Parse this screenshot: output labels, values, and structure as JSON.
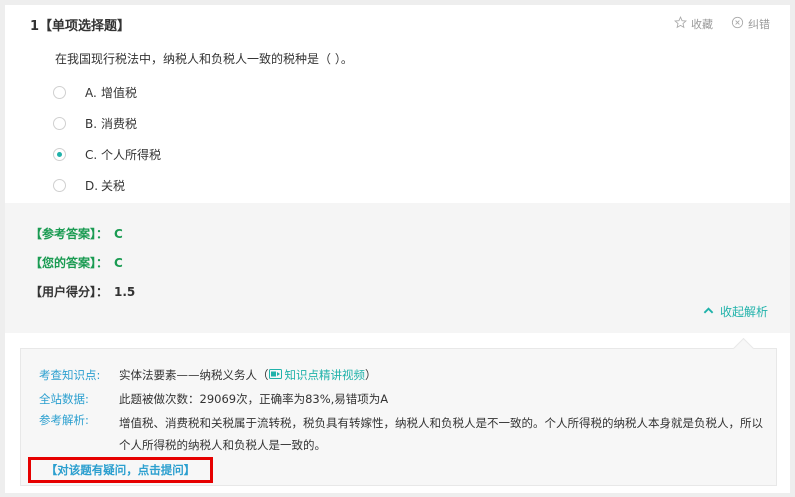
{
  "question": {
    "number_label": "1【单项选择题】",
    "stem": "在我国现行税法中，纳税人和负税人一致的税种是（ ）。",
    "favorite_label": "收藏",
    "report_label": "纠错",
    "options": [
      {
        "letter": "A.",
        "text": "增值税",
        "selected": false
      },
      {
        "letter": "B.",
        "text": "消费税",
        "selected": false
      },
      {
        "letter": "C.",
        "text": "个人所得税",
        "selected": true
      },
      {
        "letter": "D.",
        "text": "关税",
        "selected": false
      }
    ]
  },
  "answer": {
    "reference_label": "【参考答案】：",
    "reference_value": "C",
    "yours_label": "【您的答案】：",
    "yours_value": "C",
    "score_label": "【用户得分】：",
    "score_value": "1.5",
    "collapse_label": "收起解析"
  },
  "analysis": {
    "knowledge_label": "考查知识点:",
    "knowledge_text": "实体法要素——纳税义务人（",
    "video_link": "知识点精讲视频",
    "knowledge_close": "）",
    "stats_label": "全站数据:",
    "stats_text": "此题被做次数：29069次，正确率为83%,易错项为A",
    "ref_label": "参考解析:",
    "ref_text": "增值税、消费税和关税属于流转税，税负具有转嫁性，纳税人和负税人是不一致的。个人所得税的纳税人本身就是负税人，所以个人所得税的纳税人和负税人是一致的。",
    "ask_button": "【对该题有疑问，点击提问】"
  },
  "colors": {
    "accent": "#20b2aa",
    "label_blue": "#2b9fcf",
    "answer_green": "#1a9b52",
    "highlight_red": "#e60000"
  }
}
